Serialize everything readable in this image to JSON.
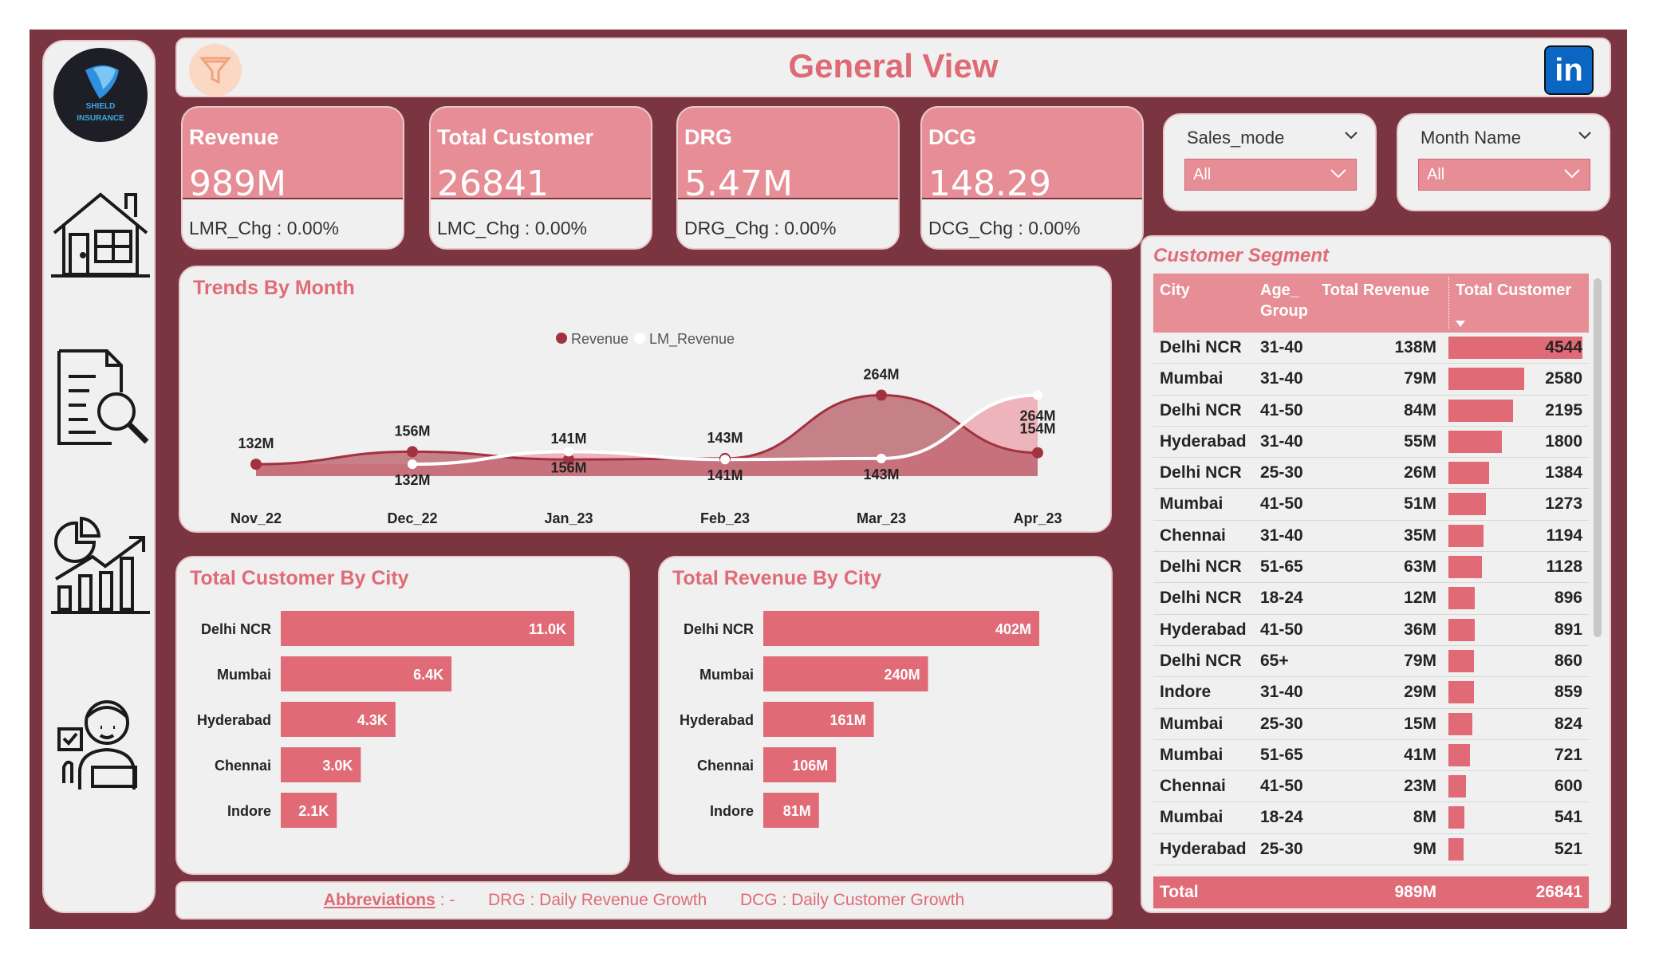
{
  "header": {
    "title": "General View",
    "filter_icon": "funnel-icon",
    "social_icon": "linkedin-icon",
    "social_label": "in"
  },
  "logo": {
    "line1": "SHIELD",
    "line2": "INSURANCE"
  },
  "sidebar": {
    "items": [
      {
        "icon": "home-icon"
      },
      {
        "icon": "report-search-icon"
      },
      {
        "icon": "growth-chart-icon"
      },
      {
        "icon": "customer-support-icon"
      }
    ]
  },
  "kpis": [
    {
      "name": "Revenue",
      "value": "989M",
      "change": "LMR_Chg : 0.00%"
    },
    {
      "name": "Total Customer",
      "value": "26841",
      "change": "LMC_Chg : 0.00%"
    },
    {
      "name": "DRG",
      "value": "5.47M",
      "change": "DRG_Chg : 0.00%"
    },
    {
      "name": "DCG",
      "value": "148.29",
      "change": "DCG_Chg : 0.00%"
    }
  ],
  "slicers": [
    {
      "name": "Sales_mode",
      "selected": "All"
    },
    {
      "name": "Month Name",
      "selected": "All"
    }
  ],
  "trend": {
    "title": "Trends By Month",
    "legend": [
      "Revenue",
      "LM_Revenue"
    ],
    "months": [
      "Nov_22",
      "Dec_22",
      "Jan_23",
      "Feb_23",
      "Mar_23",
      "Apr_23"
    ],
    "revenue": [
      132,
      156,
      141,
      143,
      264,
      154
    ],
    "lm_revenue": [
      null,
      132,
      156,
      141,
      143,
      264
    ],
    "revenue_labels": [
      "132M",
      "156M",
      "141M",
      "143M",
      "264M",
      "154M"
    ],
    "lm_labels": [
      "",
      "132M",
      "156M",
      "141M",
      "143M",
      "264M"
    ]
  },
  "colors": {
    "accent": "#e06b77",
    "frame": "#7b3540",
    "revenue_area": "#b85b66",
    "lm_area": "#ecb1b7"
  },
  "customer_by_city": {
    "title": "Total Customer By City",
    "categories": [
      "Delhi NCR",
      "Mumbai",
      "Hyderabad",
      "Chennai",
      "Indore"
    ],
    "values": [
      11.0,
      6.4,
      4.3,
      3.0,
      2.1
    ],
    "labels": [
      "11.0K",
      "6.4K",
      "4.3K",
      "3.0K",
      "2.1K"
    ]
  },
  "revenue_by_city": {
    "title": "Total Revenue By City",
    "categories": [
      "Delhi NCR",
      "Mumbai",
      "Hyderabad",
      "Chennai",
      "Indore"
    ],
    "values": [
      402,
      240,
      161,
      106,
      81
    ],
    "labels": [
      "402M",
      "240M",
      "161M",
      "106M",
      "81M"
    ]
  },
  "chart_data": [
    {
      "type": "area",
      "title": "Trends By Month",
      "x": [
        "Nov_22",
        "Dec_22",
        "Jan_23",
        "Feb_23",
        "Mar_23",
        "Apr_23"
      ],
      "series": [
        {
          "name": "Revenue",
          "values": [
            132,
            156,
            141,
            143,
            264,
            154
          ]
        },
        {
          "name": "LM_Revenue",
          "values": [
            null,
            132,
            156,
            141,
            143,
            264
          ]
        }
      ]
    },
    {
      "type": "bar",
      "title": "Total Customer By City",
      "categories": [
        "Delhi NCR",
        "Mumbai",
        "Hyderabad",
        "Chennai",
        "Indore"
      ],
      "values": [
        11.0,
        6.4,
        4.3,
        3.0,
        2.1
      ]
    },
    {
      "type": "bar",
      "title": "Total Revenue By City",
      "categories": [
        "Delhi NCR",
        "Mumbai",
        "Hyderabad",
        "Chennai",
        "Indore"
      ],
      "values": [
        402,
        240,
        161,
        106,
        81
      ]
    }
  ],
  "segment": {
    "title": "Customer Segment",
    "columns": [
      "City",
      "Age_ Group",
      "Total Revenue",
      "Total Customer"
    ],
    "rows": [
      {
        "city": "Delhi NCR",
        "age": "31-40",
        "revenue": "138M",
        "customers": "4544",
        "count": 4544
      },
      {
        "city": "Mumbai",
        "age": "31-40",
        "revenue": "79M",
        "customers": "2580",
        "count": 2580
      },
      {
        "city": "Delhi NCR",
        "age": "41-50",
        "revenue": "84M",
        "customers": "2195",
        "count": 2195
      },
      {
        "city": "Hyderabad",
        "age": "31-40",
        "revenue": "55M",
        "customers": "1800",
        "count": 1800
      },
      {
        "city": "Delhi NCR",
        "age": "25-30",
        "revenue": "26M",
        "customers": "1384",
        "count": 1384
      },
      {
        "city": "Mumbai",
        "age": "41-50",
        "revenue": "51M",
        "customers": "1273",
        "count": 1273
      },
      {
        "city": "Chennai",
        "age": "31-40",
        "revenue": "35M",
        "customers": "1194",
        "count": 1194
      },
      {
        "city": "Delhi NCR",
        "age": "51-65",
        "revenue": "63M",
        "customers": "1128",
        "count": 1128
      },
      {
        "city": "Delhi NCR",
        "age": "18-24",
        "revenue": "12M",
        "customers": "896",
        "count": 896
      },
      {
        "city": "Hyderabad",
        "age": "41-50",
        "revenue": "36M",
        "customers": "891",
        "count": 891
      },
      {
        "city": "Delhi NCR",
        "age": "65+",
        "revenue": "79M",
        "customers": "860",
        "count": 860
      },
      {
        "city": "Indore",
        "age": "31-40",
        "revenue": "29M",
        "customers": "859",
        "count": 859
      },
      {
        "city": "Mumbai",
        "age": "25-30",
        "revenue": "15M",
        "customers": "824",
        "count": 824
      },
      {
        "city": "Mumbai",
        "age": "51-65",
        "revenue": "41M",
        "customers": "721",
        "count": 721
      },
      {
        "city": "Chennai",
        "age": "41-50",
        "revenue": "23M",
        "customers": "600",
        "count": 600
      },
      {
        "city": "Mumbai",
        "age": "18-24",
        "revenue": "8M",
        "customers": "541",
        "count": 541
      },
      {
        "city": "Hyderabad",
        "age": "25-30",
        "revenue": "9M",
        "customers": "521",
        "count": 521
      }
    ],
    "total": {
      "label": "Total",
      "revenue": "989M",
      "customers": "26841"
    }
  },
  "abbreviations": {
    "label": "Abbreviations",
    "separator": ": -",
    "items": [
      "DRG : Daily Revenue Growth",
      "DCG : Daily Customer Growth"
    ]
  }
}
